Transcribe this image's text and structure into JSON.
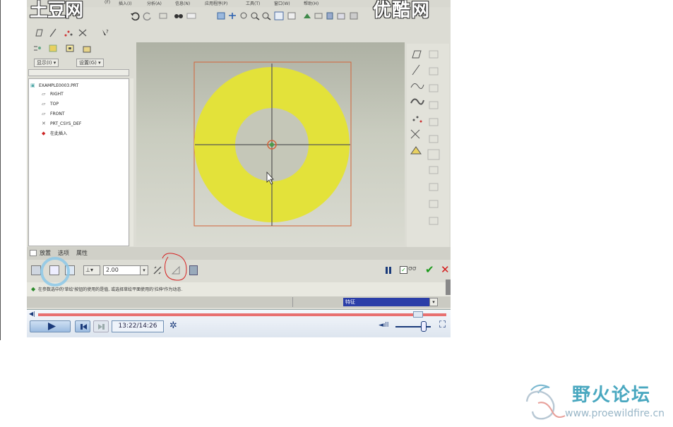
{
  "watermarks": {
    "left": "土豆网",
    "right": "优酷网"
  },
  "menu": {
    "items": [
      "(F)",
      "插入(I)",
      "分析(A)",
      "信息(N)",
      "应用程序(P)",
      "工具(T)",
      "窗口(W)",
      "帮助(H)"
    ]
  },
  "sidebar": {
    "show_button": "显示(I) ▾",
    "settings_button": "设置(G) ▾",
    "tree": [
      {
        "label": "EXAMPLE0003.PRT",
        "icon": "part-icon"
      },
      {
        "label": "RIGHT",
        "icon": "datum-plane-icon"
      },
      {
        "label": "TOP",
        "icon": "datum-plane-icon"
      },
      {
        "label": "FRONT",
        "icon": "datum-plane-icon"
      },
      {
        "label": "PRT_CSYS_DEF",
        "icon": "csys-icon"
      },
      {
        "label": "在此插入",
        "icon": "insert-here-icon"
      }
    ]
  },
  "dashboard": {
    "tabs": [
      "放置",
      "选项",
      "属性"
    ],
    "depth_value": "2.00",
    "message": "在参数选中的'草绘'按钮的使用的是值, 或选择草绘平面使用的'拉伸'作为动态.",
    "filter": "特征"
  },
  "player": {
    "time": "13:22/14:26",
    "progress": 0.93,
    "volume": 0.8
  },
  "logo": {
    "title": "野火论坛",
    "url": "www.proewildfire.cn"
  },
  "colors": {
    "model": "#e3e23a",
    "sketch": "#d2643a",
    "seek": "#e87070",
    "logo": "#4aa8c0",
    "annotation": "#d62020"
  }
}
